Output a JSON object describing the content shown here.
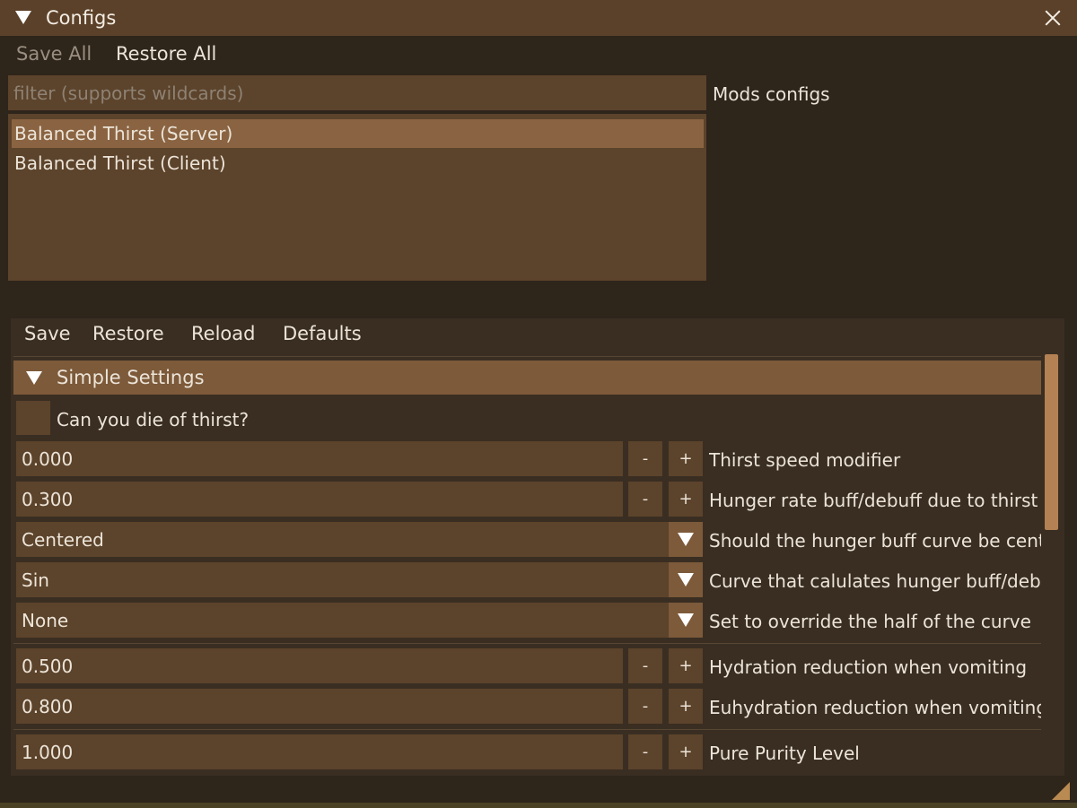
{
  "window": {
    "title": "Configs"
  },
  "menu": {
    "save_all": "Save All",
    "restore_all": "Restore All"
  },
  "filter": {
    "placeholder": "filter (supports wildcards)",
    "value": ""
  },
  "mods_label": "Mods configs",
  "mods_list": [
    {
      "label": "Balanced Thirst (Server)",
      "selected": true
    },
    {
      "label": "Balanced Thirst (Client)",
      "selected": false
    }
  ],
  "config_toolbar": {
    "save": "Save",
    "restore": "Restore",
    "reload": "Reload",
    "defaults": "Defaults"
  },
  "section": {
    "title": "Simple Settings"
  },
  "settings": {
    "die_of_thirst": {
      "label": "Can you die of thirst?",
      "checked": false
    },
    "thirst_speed": {
      "value": "0.000",
      "label": "Thirst speed modifier"
    },
    "hunger_rate": {
      "value": "0.300",
      "label": "Hunger rate buff/debuff due to thirst"
    },
    "hunger_curve_centered": {
      "value": "Centered",
      "label": "Should the hunger buff curve be centered"
    },
    "hunger_curve": {
      "value": "Sin",
      "label": "Curve that calulates hunger buff/debuff"
    },
    "curve_half_override": {
      "value": "None",
      "label": "Set to override the half of the curve"
    },
    "hydration_vomit": {
      "value": "0.500",
      "label": "Hydration reduction when vomiting"
    },
    "euhydration_vomit": {
      "value": "0.800",
      "label": "Euhydration reduction when vomiting"
    },
    "pure_purity": {
      "value": "1.000",
      "label": "Pure Purity Level"
    }
  },
  "stepper": {
    "minus": "-",
    "plus": "+"
  },
  "colors": {
    "accent": "#8a6442",
    "field": "#5c432b",
    "header": "#7c5a3a",
    "scrollbar": "#b38153"
  },
  "icons": {
    "collapse": "triangle-down-icon",
    "close": "close-icon",
    "dropdown": "triangle-down-icon",
    "resize": "resize-grip-icon"
  }
}
